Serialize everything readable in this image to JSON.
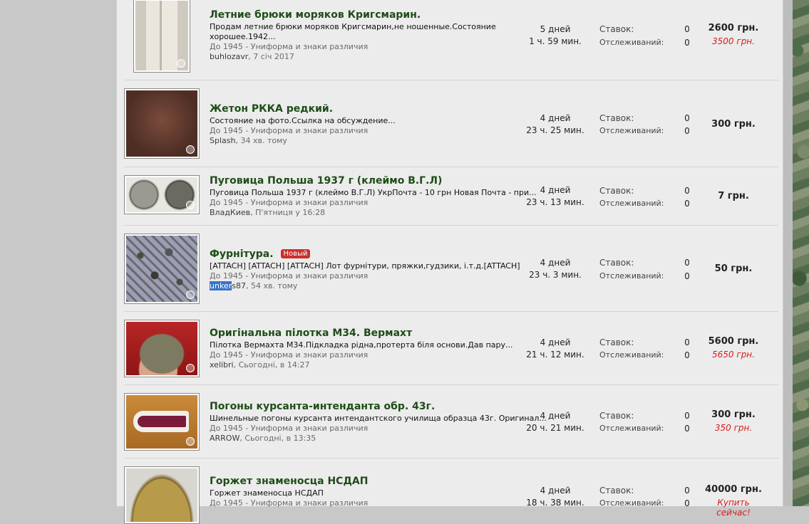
{
  "labels": {
    "bids": "Ставок:",
    "watching": "Отслеживаний:"
  },
  "items": [
    {
      "title": "Летние брюки моряков Кригсмарин.",
      "badge": "",
      "desc": "Продам летние брюки моряков Кригсмарин,не ношенные.Состояние хорошее.1942...",
      "category": "До 1945 - Униформа и знаки различия",
      "user": "buhlozavr",
      "user_hl": "",
      "date": ", 7 січ 2017",
      "time1": "5 дней",
      "time2": "1 ч. 59 мин.",
      "bids": "0",
      "watchers": "0",
      "price": "2600 грн.",
      "price_alt": "3500 грн.",
      "thumb": "trousers"
    },
    {
      "title": "Жетон РККА редкий.",
      "badge": "",
      "desc": "Состояние на фото.Ссылка на обсуждение...",
      "category": "До 1945 - Униформа и знаки различия",
      "user": "Splash",
      "user_hl": "",
      "date": ", 34 хв. тому",
      "time1": "4 дней",
      "time2": "23 ч. 25 мин.",
      "bids": "0",
      "watchers": "0",
      "price": "300 грн.",
      "price_alt": "",
      "thumb": "tag"
    },
    {
      "title": "Пуговица Польша 1937 г (клеймо В.Г.Л)",
      "badge": "",
      "desc": "Пуговица Польша 1937 г (клеймо В.Г.Л) УкрПочта - 10 грн Новая Почта - при...",
      "category": "До 1945 - Униформа и знаки различия",
      "user": "ВладКиев",
      "user_hl": "",
      "date": ", П'ятниця у 16:28",
      "time1": "4 дней",
      "time2": "23 ч. 13 мин.",
      "bids": "0",
      "watchers": "0",
      "price": "7 грн.",
      "price_alt": "",
      "thumb": "buttons"
    },
    {
      "title": "Фурнітура.",
      "badge": "Новый",
      "desc": "[ATTACH] [ATTACH] [ATTACH] Лот фурнітури, пряжки,гудзики, і.т.д.[ATTACH]",
      "category": "До 1945 - Униформа и знаки различия",
      "user": "s87",
      "user_hl": "unker",
      "date": ", 54 хв. тому",
      "time1": "4 дней",
      "time2": "23 ч. 3 мин.",
      "bids": "0",
      "watchers": "0",
      "price": "50 грн.",
      "price_alt": "",
      "thumb": "fittings"
    },
    {
      "title": "Оригінальна пілотка М34. Вермахт",
      "badge": "",
      "desc": "Пілотка Вермахта М34.Підкладка рідна,протерта біля основи.Дав пару...",
      "category": "До 1945 - Униформа и знаки различия",
      "user": "xelibri",
      "user_hl": "",
      "date": ", Сьогодні, в 14:27",
      "time1": "4 дней",
      "time2": "21 ч. 12 мин.",
      "bids": "0",
      "watchers": "0",
      "price": "5600 грн.",
      "price_alt": "5650 грн.",
      "thumb": "cap"
    },
    {
      "title": "Погоны курсанта-интенданта обр. 43г.",
      "badge": "",
      "desc": "Шинельные погоны курсанта интендантского училища образца 43г. Оригинал...",
      "category": "До 1945 - Униформа и знаки различия",
      "user": "ARROW",
      "user_hl": "",
      "date": ", Сьогодні, в 13:35",
      "time1": "4 дней",
      "time2": "20 ч. 21 мин.",
      "bids": "0",
      "watchers": "0",
      "price": "300 грн.",
      "price_alt": "350 грн.",
      "thumb": "boards"
    },
    {
      "title": "Горжет знаменосца НСДАП",
      "badge": "",
      "desc": "Горжет знаменосца НСДАП",
      "category": "До 1945 - Униформа и знаки различия",
      "user": "",
      "user_hl": "",
      "date": "",
      "time1": "4 дней",
      "time2": "18 ч. 38 мин.",
      "bids": "0",
      "watchers": "0",
      "price": "40000 грн.",
      "price_alt": "Купить сейчас!",
      "thumb": "gorget"
    }
  ]
}
